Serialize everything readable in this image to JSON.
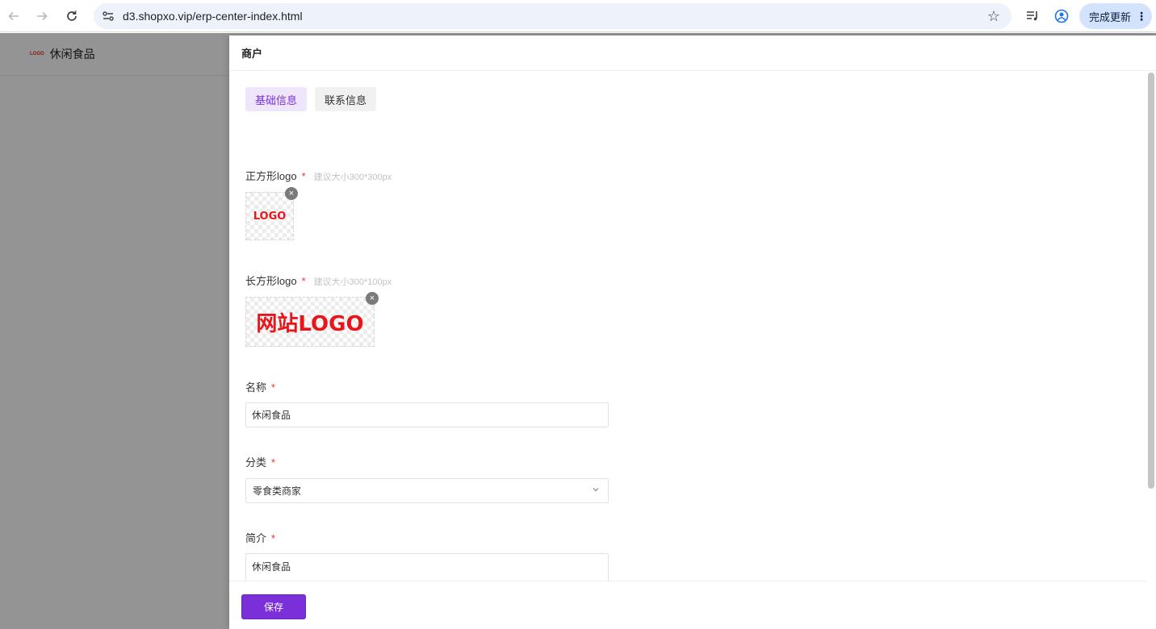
{
  "browser": {
    "url": "d3.shopxo.vip/erp-center-index.html",
    "update_label": "完成更新"
  },
  "background": {
    "logo_text": "LOGO",
    "store_name": "休闲食品"
  },
  "drawer": {
    "title": "商户",
    "tabs": [
      {
        "label": "基础信息",
        "active": true
      },
      {
        "label": "联系信息",
        "active": false
      }
    ],
    "square_logo": {
      "label": "正方形logo",
      "required": "*",
      "hint": "建议大小300*300px",
      "image_text": "LOGO",
      "remove": "×"
    },
    "rect_logo": {
      "label": "长方形logo",
      "required": "*",
      "hint": "建议大小300*100px",
      "image_text": "网站LOGO",
      "remove": "×"
    },
    "name": {
      "label": "名称",
      "required": "*",
      "value": "休闲食品"
    },
    "category": {
      "label": "分类",
      "required": "*",
      "value": "零食类商家"
    },
    "intro": {
      "label": "简介",
      "required": "*",
      "value": "休闲食品"
    },
    "save_label": "保存"
  },
  "colors": {
    "accent": "#7b2fd9",
    "required": "#e33333",
    "logo_red": "#e8161b"
  }
}
